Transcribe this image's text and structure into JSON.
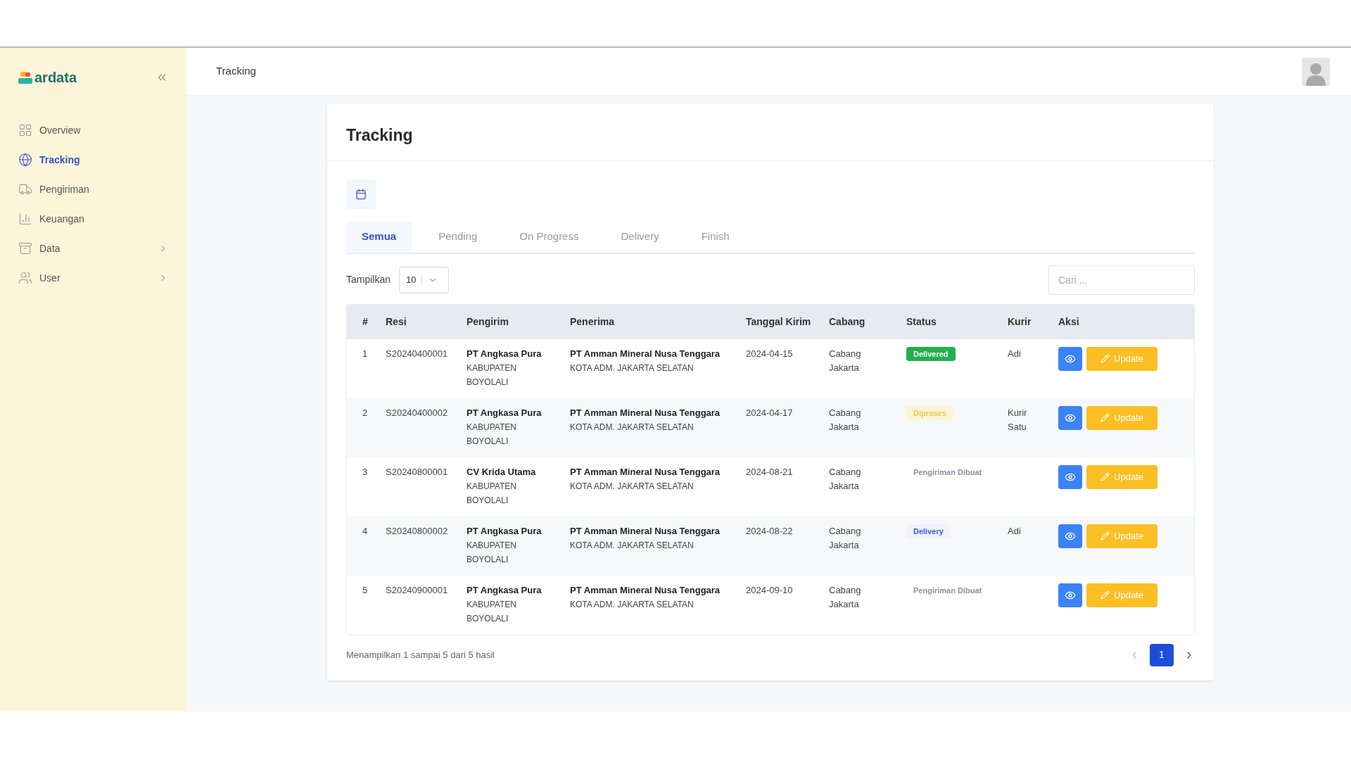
{
  "logo": {
    "text": "ardata"
  },
  "sidebar": {
    "items": [
      {
        "label": "Overview",
        "selected": false,
        "has_submenu": false
      },
      {
        "label": "Tracking",
        "selected": true,
        "has_submenu": false
      },
      {
        "label": "Pengiriman",
        "selected": false,
        "has_submenu": false
      },
      {
        "label": "Keuangan",
        "selected": false,
        "has_submenu": false
      },
      {
        "label": "Data",
        "selected": false,
        "has_submenu": true
      },
      {
        "label": "User",
        "selected": false,
        "has_submenu": true
      }
    ]
  },
  "header": {
    "breadcrumb": "Tracking"
  },
  "page": {
    "title": "Tracking"
  },
  "tabs": [
    {
      "label": "Semua",
      "selected": true
    },
    {
      "label": "Pending",
      "selected": false
    },
    {
      "label": "On Progress",
      "selected": false
    },
    {
      "label": "Delivery",
      "selected": false
    },
    {
      "label": "Finish",
      "selected": false
    }
  ],
  "page_size": {
    "label": "Tampilkan",
    "value": "10"
  },
  "search": {
    "placeholder": "Cari ..."
  },
  "table": {
    "columns": [
      "#",
      "Resi",
      "Pengirim",
      "Penerima",
      "Tanggal Kirim",
      "Cabang",
      "Status",
      "Kurir",
      "Aksi"
    ],
    "rows": [
      {
        "no": "1",
        "resi": "S20240400001",
        "sender": "PT Angkasa Pura",
        "sender_region": "KABUPATEN BOYOLALI",
        "recipient": "PT Amman Mineral Nusa Tenggara",
        "recipient_region": "KOTA ADM. JAKARTA SELATAN",
        "date": "2024-04-15",
        "branch": "Cabang Jakarta",
        "status": {
          "label": "Delivered",
          "kind": "delivered"
        },
        "courier": "Adi",
        "update": "Update"
      },
      {
        "no": "2",
        "resi": "S20240400002",
        "sender": "PT Angkasa Pura",
        "sender_region": "KABUPATEN BOYOLALI",
        "recipient": "PT Amman Mineral Nusa Tenggara",
        "recipient_region": "KOTA ADM. JAKARTA SELATAN",
        "date": "2024-04-17",
        "branch": "Cabang Jakarta",
        "status": {
          "label": "Diproses",
          "kind": "processing"
        },
        "courier": "Kurir Satu",
        "update": "Update"
      },
      {
        "no": "3",
        "resi": "S20240800001",
        "sender": "CV Krida Utama",
        "sender_region": "KABUPATEN BOYOLALI",
        "recipient": "PT Amman Mineral Nusa Tenggara",
        "recipient_region": "KOTA ADM. JAKARTA SELATAN",
        "date": "2024-08-21",
        "branch": "Cabang Jakarta",
        "status": {
          "label": "Pengiriman Dibuat",
          "kind": "created"
        },
        "update": "Update"
      },
      {
        "no": "4",
        "resi": "S20240800002",
        "sender": "PT Angkasa Pura",
        "sender_region": "KABUPATEN BOYOLALI",
        "recipient": "PT Amman Mineral Nusa Tenggara",
        "recipient_region": "KOTA ADM. JAKARTA SELATAN",
        "date": "2024-08-22",
        "branch": "Cabang Jakarta",
        "status": {
          "label": "Delivery",
          "kind": "delivery"
        },
        "courier": "Adi",
        "update": "Update"
      },
      {
        "no": "5",
        "resi": "S20240900001",
        "sender": "PT Angkasa Pura",
        "sender_region": "KABUPATEN BOYOLALI",
        "recipient": "PT Amman Mineral Nusa Tenggara",
        "recipient_region": "KOTA ADM. JAKARTA SELATAN",
        "date": "2024-09-10",
        "branch": "Cabang Jakarta",
        "status": {
          "label": "Pengiriman Dibuat",
          "kind": "created"
        },
        "update": "Update"
      }
    ]
  },
  "footer": {
    "summary": "Menampilkan 1 sampai 5 dari 5 hasil"
  },
  "pagination": {
    "pages": [
      {
        "label": "1",
        "selected": true
      }
    ]
  }
}
